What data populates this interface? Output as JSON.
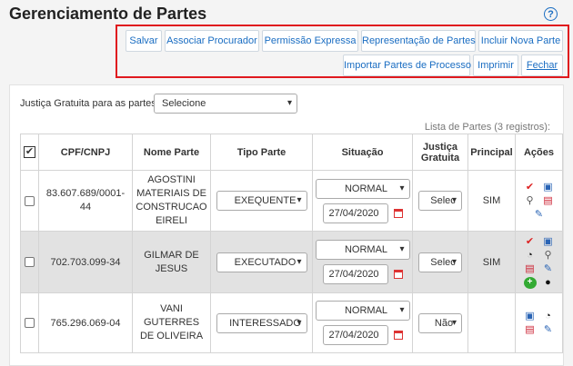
{
  "page": {
    "title": "Gerenciamento de Partes",
    "help": "?"
  },
  "toolbar": {
    "salvar": "Salvar",
    "associar": "Associar Procurador",
    "permissao": "Permissão Expressa",
    "representacao": "Representação de Partes",
    "incluir": "Incluir Nova Parte",
    "importar": "Importar Partes de Processo",
    "imprimir": "Imprimir",
    "fechar": "Fechar"
  },
  "filters": {
    "justica_label": "Justiça Gratuita para as partes",
    "justica_value": "Selecione"
  },
  "list": {
    "count": "Lista de Partes (3 registros):"
  },
  "table": {
    "headers": {
      "check": "✔",
      "cpf": "CPF/CNPJ",
      "nome": "Nome Parte",
      "tipo": "Tipo Parte",
      "situacao": "Situação",
      "justica_1": "Justiça",
      "justica_2": "Gratuita",
      "principal": "Principal",
      "acoes": "Ações"
    },
    "rows": [
      {
        "cpf_1": "83.607.689/0001-",
        "cpf_2": "44",
        "nome_1": "AGOSTINI",
        "nome_2": "MATERIAIS DE",
        "nome_3": "CONSTRUCAO",
        "nome_4": "EIRELI",
        "tipo": "EXEQUENTE",
        "situacao": "NORMAL",
        "data": "27/04/2020",
        "justica": "Selec",
        "principal": "SIM"
      },
      {
        "cpf_1": "702.703.099-34",
        "nome_1": "GILMAR DE",
        "nome_2": "JESUS",
        "tipo": "EXECUTADO",
        "situacao": "NORMAL",
        "data": "27/04/2020",
        "justica": "Selec",
        "principal": "SIM"
      },
      {
        "cpf_1": "765.296.069-04",
        "nome_1": "VANI GUTERRES",
        "nome_2": "DE OLIVEIRA",
        "tipo": "INTERESSADO",
        "situacao": "NORMAL",
        "data": "27/04/2020",
        "justica": "Não",
        "principal": ""
      }
    ]
  },
  "colors": {
    "link": "#1a6dc2",
    "highlight": "#e0191e",
    "row_alt": "#e2e2e2"
  },
  "icons": [
    "help-icon",
    "check-icon",
    "edit-icon",
    "search-icon",
    "document-icon",
    "note-icon",
    "hide-icon",
    "add-icon",
    "user-icon",
    "calendar-icon",
    "chevron-down-icon"
  ]
}
